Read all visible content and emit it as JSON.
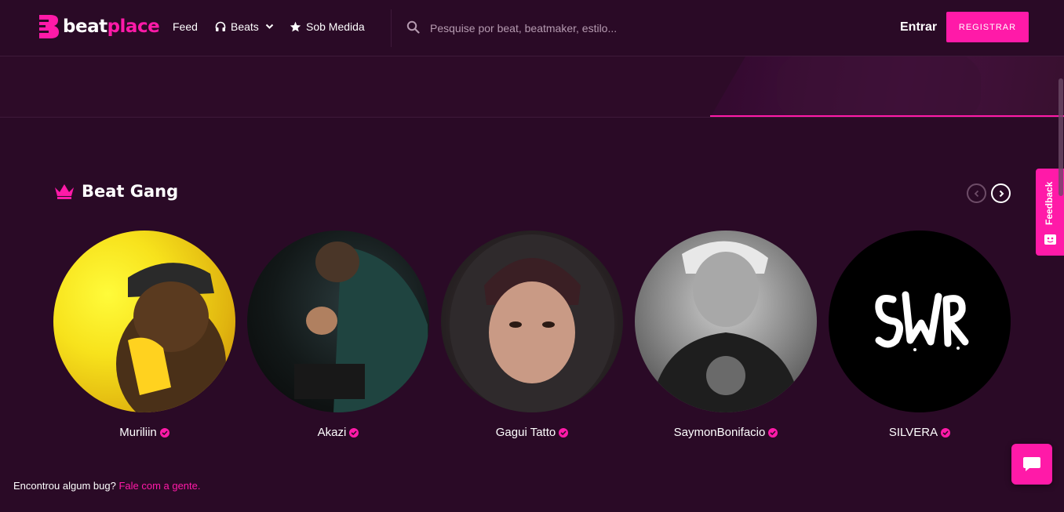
{
  "header": {
    "logo_part1": "beat",
    "logo_part2": "place",
    "nav": {
      "feed": "Feed",
      "beats": "Beats",
      "sob_medida": "Sob Medida"
    },
    "search_placeholder": "Pesquise por beat, beatmaker, estilo...",
    "login": "Entrar",
    "register": "REGISTRAR"
  },
  "section": {
    "title": "Beat Gang",
    "artists": [
      {
        "name": "Muriliin"
      },
      {
        "name": "Akazi"
      },
      {
        "name": "Gagui Tatto"
      },
      {
        "name": "SaymonBonifacio"
      },
      {
        "name": "SILVERA"
      }
    ]
  },
  "feedback": {
    "label": "Feedback"
  },
  "footer": {
    "bug_text": "Encontrou algum bug?",
    "bug_link": "Fale com a gente."
  },
  "colors": {
    "accent": "#ff1aa8",
    "background": "#2a0a26"
  }
}
